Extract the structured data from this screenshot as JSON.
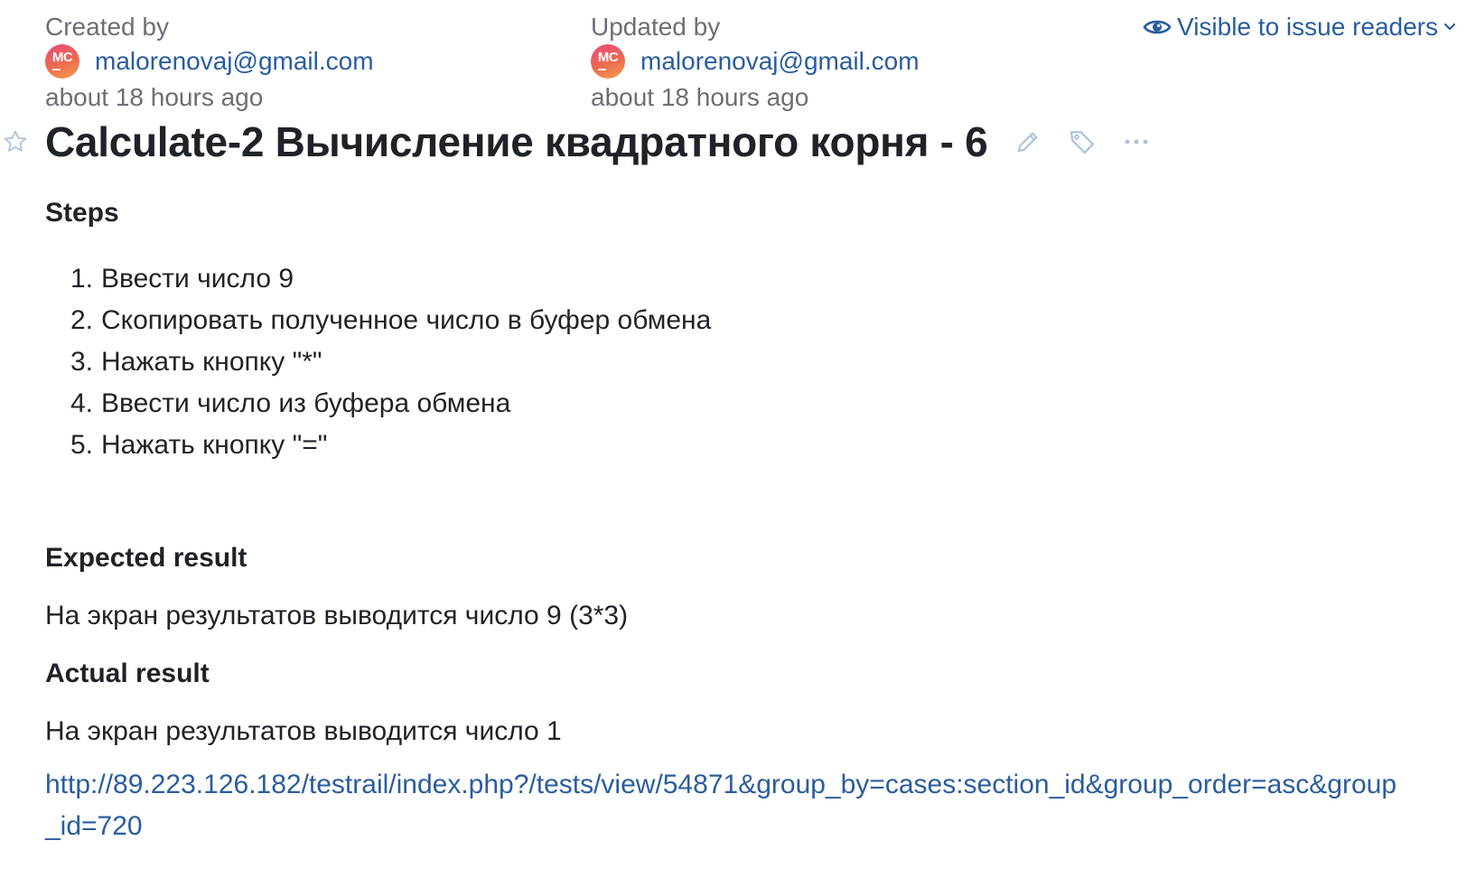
{
  "meta": {
    "created_label": "Created by",
    "created_avatar": "MC",
    "created_email": "malorenovaj@gmail.com",
    "created_time": "about 18 hours ago",
    "updated_label": "Updated by",
    "updated_avatar": "MC",
    "updated_email": "malorenovaj@gmail.com",
    "updated_time": "about 18 hours ago"
  },
  "visibility": {
    "label": "Visible to issue readers",
    "icon": "eye-icon",
    "dropdown_icon": "chevron-down-icon"
  },
  "issue": {
    "title": "Calculate-2 Вычисление квадратного корня - 6",
    "star_icon": "star-icon",
    "edit_icon": "pencil-icon",
    "tag_icon": "tag-icon",
    "more_icon": "ellipsis-icon"
  },
  "body": {
    "steps_heading": "Steps",
    "steps": [
      {
        "num": "1.",
        "text": "Ввести число 9"
      },
      {
        "num": "2.",
        "text": "Скопировать полученное число в буфер обмена"
      },
      {
        "num": "3.",
        "text": "Нажать кнопку \"*\""
      },
      {
        "num": "4.",
        "text": "Ввести число из буфера обмена"
      },
      {
        "num": "5.",
        "text": "Нажать кнопку \"=\""
      }
    ],
    "expected_heading": "Expected result",
    "expected_text": "На экран результатов выводится число 9 (3*3)",
    "actual_heading": "Actual result",
    "actual_text": "На экран результатов выводится число 1",
    "link": "http://89.223.126.182/testrail/index.php?/tests/view/54871&group_by=cases:section_id&group_order=asc&group_id=720"
  },
  "colors": {
    "link": "#2a5d9e",
    "text": "#1f2328",
    "muted": "#6b6f75",
    "icon_light": "#a9c0db"
  }
}
